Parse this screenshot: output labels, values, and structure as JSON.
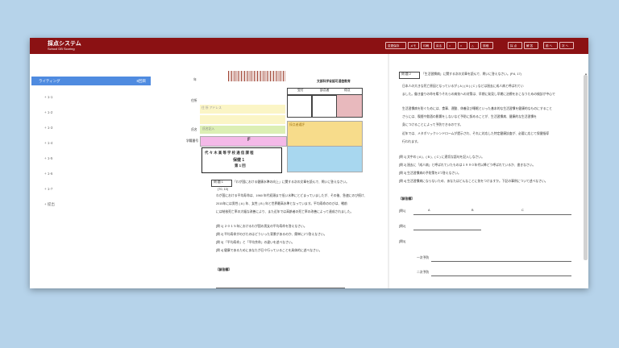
{
  "app": {
    "title": "採点システム",
    "subtitle": "School DB Scoring"
  },
  "toolbar": [
    {
      "id": "save",
      "label": "変更保存"
    },
    {
      "id": "t2",
      "label": "メモ"
    },
    {
      "id": "t3",
      "label": "印刷"
    },
    {
      "id": "t4",
      "label": "戻る"
    },
    {
      "id": "t5",
      "label": "○"
    },
    {
      "id": "t6",
      "label": "×"
    },
    {
      "id": "t7",
      "label": "△"
    },
    {
      "id": "t8",
      "label": "詳細"
    },
    {
      "id": "t9",
      "label": "採 点"
    },
    {
      "id": "t10",
      "label": "解 答"
    },
    {
      "id": "t11",
      "label": "前 へ"
    },
    {
      "id": "t12",
      "label": "次 へ"
    }
  ],
  "sidebar": {
    "active": {
      "label": "ライティング",
      "count": "8回目"
    },
    "items": [
      "1-1",
      "1-2",
      "1-3",
      "1-4",
      "1-5",
      "1-6",
      "1-7",
      "提出"
    ]
  },
  "page_left": {
    "year_label": "年",
    "ministry": "文部科学省認可通信教育",
    "score_headers": [
      "受付",
      "部点者",
      "得点"
    ],
    "address_label": "住所",
    "address_value": "住 所 アドレス",
    "name_label": "氏名",
    "name_value": "氏名記入",
    "student_no_label": "学籍番号",
    "student_no_code": "F",
    "comment_label": "採点者通評",
    "school": "代 々 木 高 等 学 校 通 信 課 程",
    "subject": "保健 1",
    "session": "第 1 回",
    "q1_header": "問 題 1",
    "q1_title": "「わが国における健康水準の向上」に関する次の文章を読んで、問いに答えなさい。",
    "q1_points": "(70, 10)",
    "body1": "わが国における平均寿命は、1960 年代初頭まで低い水準にとどまっていましたが、その後、急速にのび続け、",
    "body2": "2015年には男性 ( A ) 年、女性 ( B ) 年と世界最高水準となっています。平均寿命ののびは、戦前",
    "body3": "には結核死亡率の大幅な改善により、また近年では高齢者の死亡率の改善によって達成されました。",
    "ask1": "[問 1] ２０１５年におけるわが国の男女の平均寿命を答えなさい。",
    "ask2": "[問 2] 平均寿命がのびたのはどういった背景があるのか、簡単に2つ答えなさい。",
    "ask3": "[問 3] 「平均寿命」と「平均余命」の違いを述べなさい。",
    "ask4": "[問 4] 健康であるためにあなたが日々行っていることを具体的に述べなさい。",
    "answer_header": "【解答欄】"
  },
  "page_right": {
    "q2_header": "問 題 2",
    "q2_title": "「生活習慣病」に関する次の文章を読んで、問いに答えなさい。(P.6, 17)",
    "body1": "日本人の大きな死亡原因となっているが ( A ) ( B ) ( C ) などは過去に成人病と呼ばれてい",
    "body2": "ました。働き盛りの命を奪うそれらの病気への対策は、早期に発見し早期に治療をおこなうための検診が中心で",
    "body3": "生活習慣病を防ぐためには、食事、運動、休養及び睡眠といった基本的な生活習慣を健康的なものにすること",
    "body4": "さらには、喫煙や飲酒の影響をしないなど予防に努めることが、生活習慣病、健康的な生活習慣を",
    "body5": "身につけることによって予防できるのです。",
    "body6": "近年では、メタボリックシンドロームが提示され、それに対応した特定健康診査が、必要に応じて保健指導",
    "body7": "行われます。",
    "ask1": "[問 1] 文中の ( A )、( B )、( C ) に適切な語句を記入しなさい。",
    "ask2": "[問 2] 過去に「成人病」と呼ばれていたものは１９９０年代以降どう呼ばれているか、書きなさい。",
    "ask3": "[問 3] 生活習慣病の予防策を3つ答えなさい。",
    "ask4": "[問 4] 生活習慣病にならないため、あなたはどんなことに気をつけますか。下記の事例について述べなさい。",
    "answer_header": "【解答欄】",
    "ans1_label": "[問1]",
    "ans1_a": "A",
    "ans1_b": "B",
    "ans1_c": "C",
    "ans2_label": "[問2]",
    "ans3_label": "[問3]",
    "ans3_sub1": "一次予防",
    "ans3_sub2": "二次予防"
  },
  "colors": {
    "header": "#8b1113",
    "accent": "#4f8be0",
    "background": "#b6d3ea"
  }
}
